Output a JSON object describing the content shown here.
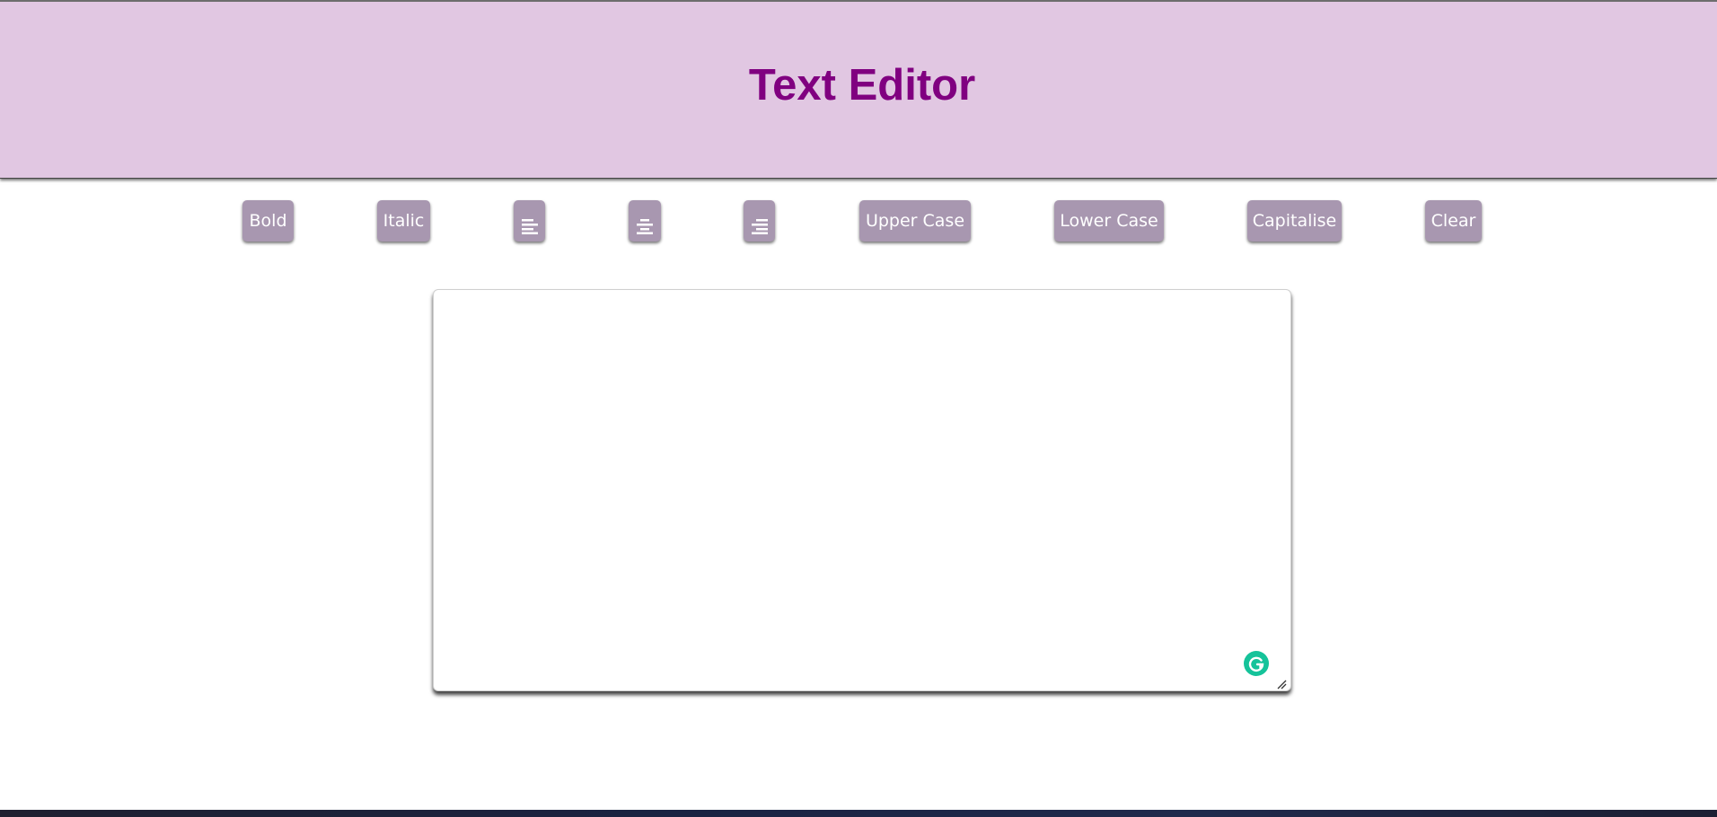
{
  "header": {
    "title": "Text Editor"
  },
  "toolbar": {
    "bold_label": "Bold",
    "italic_label": "Italic",
    "align_left_icon": "align-left-icon",
    "align_center_icon": "align-center-icon",
    "align_right_icon": "align-right-icon",
    "upper_case_label": "Upper Case",
    "lower_case_label": "Lower Case",
    "capitalise_label": "Capitalise",
    "clear_label": "Clear"
  },
  "editor": {
    "value": "",
    "placeholder": ""
  },
  "colors": {
    "header_background": "#e1c7e2",
    "title_color": "#800080",
    "button_background": "#a897b0",
    "button_text": "#ffffff",
    "grammarly": "#15c39a"
  }
}
